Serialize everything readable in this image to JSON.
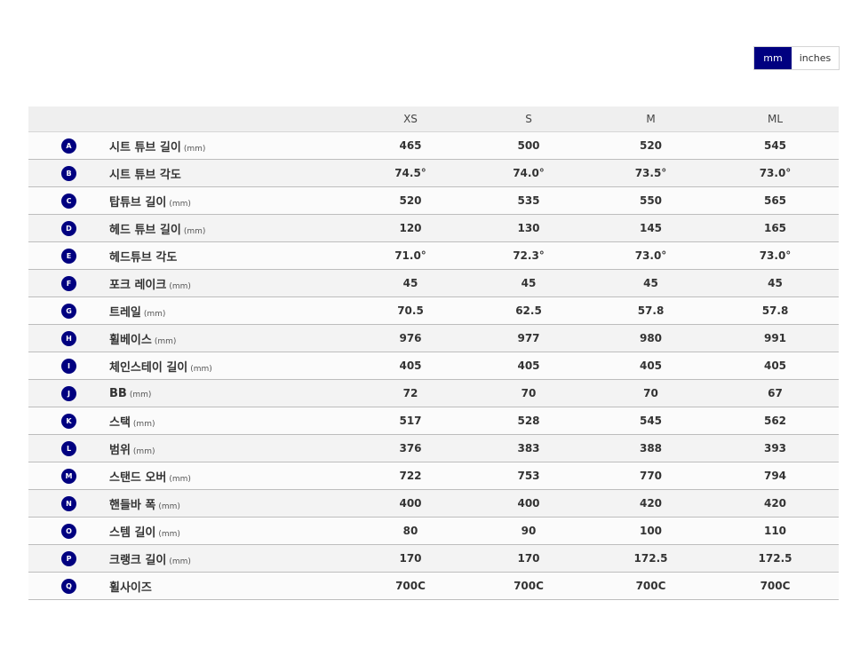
{
  "unit_toggle": {
    "mm": "mm",
    "inches": "inches",
    "active": "mm"
  },
  "brand_color": "#000080",
  "sizes": [
    "XS",
    "S",
    "M",
    "ML"
  ],
  "rows": [
    {
      "letter": "A",
      "label": "시트 튜브 길이",
      "unit": "(mm)",
      "values": [
        "465",
        "500",
        "520",
        "545"
      ]
    },
    {
      "letter": "B",
      "label": "시트 튜브 각도",
      "unit": "",
      "values": [
        "74.5°",
        "74.0°",
        "73.5°",
        "73.0°"
      ]
    },
    {
      "letter": "C",
      "label": "탑튜브 길이",
      "unit": "(mm)",
      "values": [
        "520",
        "535",
        "550",
        "565"
      ]
    },
    {
      "letter": "D",
      "label": "헤드 튜브 길이",
      "unit": "(mm)",
      "values": [
        "120",
        "130",
        "145",
        "165"
      ]
    },
    {
      "letter": "E",
      "label": "헤드튜브 각도",
      "unit": "",
      "values": [
        "71.0°",
        "72.3°",
        "73.0°",
        "73.0°"
      ]
    },
    {
      "letter": "F",
      "label": "포크 레이크",
      "unit": "(mm)",
      "values": [
        "45",
        "45",
        "45",
        "45"
      ]
    },
    {
      "letter": "G",
      "label": "트레일",
      "unit": "(mm)",
      "values": [
        "70.5",
        "62.5",
        "57.8",
        "57.8"
      ]
    },
    {
      "letter": "H",
      "label": "휠베이스",
      "unit": "(mm)",
      "values": [
        "976",
        "977",
        "980",
        "991"
      ]
    },
    {
      "letter": "I",
      "label": "체인스테이 길이",
      "unit": "(mm)",
      "values": [
        "405",
        "405",
        "405",
        "405"
      ]
    },
    {
      "letter": "J",
      "label": "BB",
      "unit": "(mm)",
      "values": [
        "72",
        "70",
        "70",
        "67"
      ]
    },
    {
      "letter": "K",
      "label": "스택",
      "unit": "(mm)",
      "values": [
        "517",
        "528",
        "545",
        "562"
      ]
    },
    {
      "letter": "L",
      "label": "범위",
      "unit": "(mm)",
      "values": [
        "376",
        "383",
        "388",
        "393"
      ]
    },
    {
      "letter": "M",
      "label": "스탠드 오버",
      "unit": "(mm)",
      "values": [
        "722",
        "753",
        "770",
        "794"
      ]
    },
    {
      "letter": "N",
      "label": "핸들바 폭",
      "unit": "(mm)",
      "values": [
        "400",
        "400",
        "420",
        "420"
      ]
    },
    {
      "letter": "O",
      "label": "스템 길이",
      "unit": "(mm)",
      "values": [
        "80",
        "90",
        "100",
        "110"
      ]
    },
    {
      "letter": "P",
      "label": "크랭크 길이",
      "unit": "(mm)",
      "values": [
        "170",
        "170",
        "172.5",
        "172.5"
      ]
    },
    {
      "letter": "Q",
      "label": "휠사이즈",
      "unit": "",
      "values": [
        "700C",
        "700C",
        "700C",
        "700C"
      ]
    }
  ]
}
